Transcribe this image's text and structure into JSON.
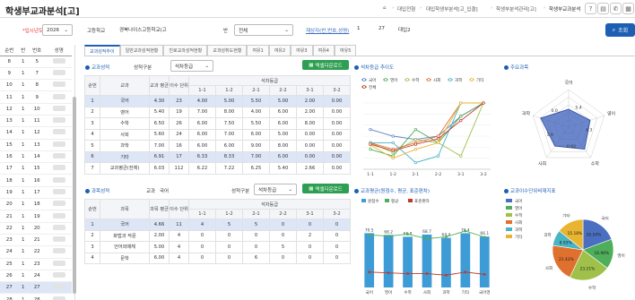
{
  "header": {
    "title": "학생부교과분석[고]",
    "breadcrumb": [
      "대입전형",
      "대입학생부분석[고_입결]",
      "학생부분석관리[고]",
      "학생부교과분석"
    ]
  },
  "filters": {
    "year_label": "*입시년도",
    "year": "2026",
    "school_label": "고등학교",
    "school": "경북나이스고등학교(고",
    "class_label": "반",
    "class": "전체",
    "search_label": "재상자(반,번호,성명)",
    "grade": "1",
    "class_no": "27",
    "name": "대입2",
    "search_button": "조회"
  },
  "students": {
    "headers": [
      "순번",
      "반",
      "번호",
      "성명"
    ],
    "rows": [
      {
        "no": "8",
        "ban": "1",
        "bun": "5"
      },
      {
        "no": "9",
        "ban": "1",
        "bun": "7"
      },
      {
        "no": "10",
        "ban": "1",
        "bun": "8"
      },
      {
        "no": "11",
        "ban": "1",
        "bun": "9"
      },
      {
        "no": "12",
        "ban": "1",
        "bun": "10"
      },
      {
        "no": "13",
        "ban": "1",
        "bun": "11"
      },
      {
        "no": "14",
        "ban": "1",
        "bun": "12"
      },
      {
        "no": "15",
        "ban": "1",
        "bun": "13"
      },
      {
        "no": "16",
        "ban": "1",
        "bun": "14"
      },
      {
        "no": "17",
        "ban": "1",
        "bun": "15"
      },
      {
        "no": "18",
        "ban": "1",
        "bun": "16"
      },
      {
        "no": "19",
        "ban": "1",
        "bun": "17"
      },
      {
        "no": "20",
        "ban": "1",
        "bun": "18"
      },
      {
        "no": "21",
        "ban": "1",
        "bun": "19"
      },
      {
        "no": "22",
        "ban": "1",
        "bun": "20"
      },
      {
        "no": "23",
        "ban": "1",
        "bun": "21"
      },
      {
        "no": "24",
        "ban": "1",
        "bun": "22"
      },
      {
        "no": "25",
        "ban": "1",
        "bun": "23"
      },
      {
        "no": "26",
        "ban": "1",
        "bun": "24"
      },
      {
        "no": "27",
        "ban": "1",
        "bun": "27"
      },
      {
        "no": "28",
        "ban": "1",
        "bun": "28"
      }
    ]
  },
  "tabs": [
    "교과성적추이",
    "일반교과성적현황",
    "진로교과성적현황",
    "교과성취도현황",
    "여유1",
    "여유2",
    "여유3",
    "여유4",
    "여유5"
  ],
  "grades_table": {
    "title": "교과성적",
    "filter_label": "성적구분",
    "filter_value": "석차등급",
    "excel": "엑셀다운로드",
    "headers": {
      "no": "순번",
      "subject": "교과",
      "avg": "교과 평균",
      "units": "이수 단위",
      "grade_group": "석차등급",
      "terms": [
        "1-1",
        "1-2",
        "2-1",
        "2-2",
        "3-1",
        "3-2"
      ]
    },
    "rows": [
      {
        "no": "1",
        "subject": "국어",
        "avg": "4.30",
        "units": "23",
        "t": [
          "4.00",
          "5.00",
          "5.50",
          "5.00",
          "2.00",
          "0.00"
        ]
      },
      {
        "no": "2",
        "subject": "영어",
        "avg": "5.40",
        "units": "19",
        "t": [
          "7.00",
          "8.00",
          "4.00",
          "6.00",
          "2.00",
          "0.00"
        ]
      },
      {
        "no": "3",
        "subject": "수학",
        "avg": "6.50",
        "units": "26",
        "t": [
          "6.00",
          "7.50",
          "5.50",
          "6.00",
          "8.00",
          "0.00"
        ]
      },
      {
        "no": "4",
        "subject": "사회",
        "avg": "5.60",
        "units": "24",
        "t": [
          "6.00",
          "7.00",
          "6.00",
          "5.00",
          "0.00",
          "0.00"
        ]
      },
      {
        "no": "5",
        "subject": "과학",
        "avg": "7.00",
        "units": "16",
        "t": [
          "6.00",
          "6.00",
          "9.00",
          "8.00",
          "0.00",
          "0.00"
        ]
      },
      {
        "no": "6",
        "subject": "기타",
        "avg": "6.91",
        "units": "17",
        "t": [
          "6.33",
          "8.33",
          "7.00",
          "6.00",
          "0.00",
          "0.00"
        ]
      },
      {
        "no": "7",
        "subject": "교과평균(전체)",
        "avg": "6.03",
        "units": "112",
        "t": [
          "6.22",
          "7.22",
          "6.25",
          "5.40",
          "2.66",
          "0.00"
        ]
      }
    ]
  },
  "trend_chart": {
    "title": "석차등급 추이도",
    "series": [
      {
        "name": "국어",
        "color": "#5b7fc4",
        "values": [
          4,
          5,
          5.5,
          5,
          2,
          0
        ]
      },
      {
        "name": "영어",
        "color": "#4fae5a",
        "values": [
          7,
          8,
          4,
          6,
          2,
          0
        ]
      },
      {
        "name": "수학",
        "color": "#9fc14a",
        "values": [
          6,
          7.5,
          5.5,
          6,
          8,
          0
        ]
      },
      {
        "name": "사회",
        "color": "#e0702d",
        "values": [
          6,
          7,
          6,
          5,
          0,
          0
        ]
      },
      {
        "name": "과학",
        "color": "#48b5c4",
        "values": [
          6,
          6,
          9,
          8,
          0,
          0
        ]
      },
      {
        "name": "기타",
        "color": "#e9b530",
        "values": [
          6.33,
          8.33,
          7,
          6,
          0,
          0
        ]
      },
      {
        "name": "전체",
        "color": "#c0392b",
        "values": [
          6.22,
          7.22,
          6.25,
          5.4,
          2.66,
          0
        ]
      }
    ],
    "x": [
      "1-1",
      "1-2",
      "2-1",
      "2-2",
      "3-1",
      "3-2"
    ]
  },
  "radar": {
    "title": "주요과목",
    "labels": [
      "국어",
      "영어",
      "수학",
      "사회",
      "과학"
    ],
    "values": [
      4.3,
      5.4,
      6.5,
      5.6,
      7.0
    ],
    "value_labels": [
      "5.4",
      "4.3",
      "0.92",
      "1.9",
      "0.0"
    ]
  },
  "course_table": {
    "title": "과목성적",
    "subject_label": "교과",
    "subject_value": "국어",
    "filter_label": "성적구분",
    "filter_value": "석차등급",
    "excel": "엑셀다운로드",
    "headers": {
      "no": "순번",
      "course": "과목",
      "avg": "과목 평균",
      "units": "이수 단위",
      "terms": [
        "1-1",
        "1-2",
        "2-1",
        "2-2",
        "3-1",
        "3-2"
      ]
    },
    "rows": [
      {
        "no": "1",
        "course": "국어",
        "avg": "4.66",
        "units": "11",
        "t": [
          "4",
          "5",
          "5",
          "0",
          "0",
          "0"
        ]
      },
      {
        "no": "2",
        "course": "화법과 작문",
        "avg": "2.00",
        "units": "4",
        "t": [
          "0",
          "0",
          "0",
          "0",
          "2",
          "0"
        ]
      },
      {
        "no": "3",
        "course": "언어와매체",
        "avg": "5.00",
        "units": "4",
        "t": [
          "0",
          "0",
          "0",
          "5",
          "0",
          "0"
        ]
      },
      {
        "no": "4",
        "course": "문학",
        "avg": "6.00",
        "units": "4",
        "t": [
          "0",
          "0",
          "6",
          "0",
          "0",
          "0"
        ]
      }
    ]
  },
  "stats_chart": {
    "title": "교과평균(원점수, 평균, 표준편차)",
    "legend": [
      "원점수",
      "평균",
      "표준편차"
    ],
    "categories": [
      "국어",
      "영어",
      "수학",
      "사회",
      "과학",
      "기타",
      "국어영"
    ],
    "bar": [
      70.5,
      68.2,
      65.8,
      68.7,
      64.4,
      70.4,
      66.1
    ],
    "avg": [
      68.2,
      66.7,
      69.3,
      63.3,
      65.8,
      73.3,
      65.4
    ],
    "std": [
      20,
      19,
      18,
      18,
      16,
      20,
      17
    ],
    "labels": [
      "70.5",
      "68.2",
      "65.8",
      "68.7",
      "64.4",
      "70.4",
      "66.1"
    ]
  },
  "pie_chart": {
    "title": "교과이수단위비재지표",
    "legend": [
      "국어",
      "영어",
      "수학",
      "사회",
      "과학",
      "기타"
    ],
    "colors": [
      "#4a6fc1",
      "#4fae5a",
      "#9fc14a",
      "#e0702d",
      "#48b5c4",
      "#e9b530"
    ],
    "values": [
      20.54,
      16.96,
      23.21,
      21.43,
      8.93,
      15.18
    ],
    "labels": [
      "20.54%",
      "16.96%",
      "23.21%",
      "21.43%",
      "8.93%",
      "15.18%"
    ],
    "names": [
      "국어",
      "영어",
      "수학",
      "사회",
      "과학",
      "기타"
    ]
  }
}
